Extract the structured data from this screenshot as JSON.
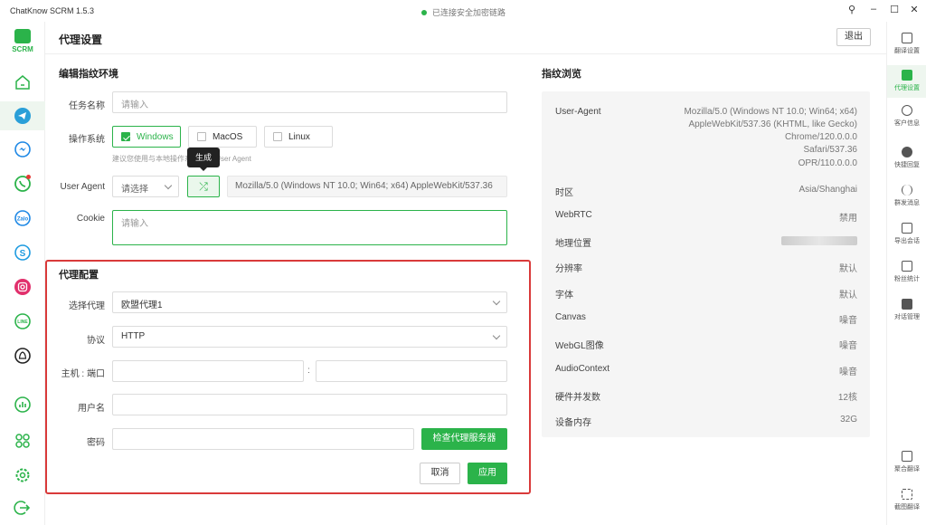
{
  "titlebar": {
    "app": "ChatKnow SCRM 1.5.3",
    "status": "已连接安全加密链路"
  },
  "logo_label": "SCRM",
  "header": {
    "title": "代理设置",
    "logout": "退出"
  },
  "fingerprint_env": {
    "section_title": "编辑指纹环境",
    "task_name_label": "任务名称",
    "task_name_placeholder": "请输入",
    "os_label": "操作系统",
    "os_options": [
      "Windows",
      "MacOS",
      "Linux"
    ],
    "os_hint": "建议您使用与本地操作系统相同 User Agent",
    "ua_label": "User Agent",
    "ua_select": "请选择",
    "ua_tooltip": "生成",
    "ua_value": "Mozilla/5.0 (Windows NT 10.0; Win64; x64) AppleWebKit/537.36",
    "cookie_label": "Cookie",
    "cookie_placeholder": "请输入"
  },
  "proxy": {
    "section_title": "代理配置",
    "select_label": "选择代理",
    "select_value": "欧盟代理1",
    "protocol_label": "协议",
    "protocol_value": "HTTP",
    "host_port_label": "主机 : 端口",
    "host_sep": ":",
    "username_label": "用户名",
    "password_label": "密码",
    "check_btn": "检查代理服务器",
    "cancel_btn": "取消",
    "apply_btn": "应用"
  },
  "preview": {
    "section_title": "指纹浏览",
    "ua_label": "User-Agent",
    "ua_lines": [
      "Mozilla/5.0 (Windows NT 10.0; Win64; x64)",
      "AppleWebKit/537.36 (KHTML, like Gecko)",
      "Chrome/120.0.0.0",
      "Safari/537.36",
      "OPR/110.0.0.0"
    ],
    "rows": [
      {
        "label": "时区",
        "value": "Asia/Shanghai"
      },
      {
        "label": "WebRTC",
        "value": "禁用"
      },
      {
        "label": "地理位置",
        "value": ""
      },
      {
        "label": "分辨率",
        "value": "默认"
      },
      {
        "label": "字体",
        "value": "默认"
      },
      {
        "label": "Canvas",
        "value": "噪音"
      },
      {
        "label": "WebGL图像",
        "value": "噪音"
      },
      {
        "label": "AudioContext",
        "value": "噪音"
      },
      {
        "label": "硬件并发数",
        "value": "12核"
      },
      {
        "label": "设备内存",
        "value": "32G"
      }
    ]
  },
  "right_tools": [
    "翻译设置",
    "代理设置",
    "客户信息",
    "快捷回复",
    "群发消息",
    "导出会话",
    "粉丝统计",
    "对话管理",
    "聚合翻译",
    "截图翻译"
  ],
  "colors": {
    "accent": "#2bb34a",
    "highlight_box": "#d93a3a"
  }
}
